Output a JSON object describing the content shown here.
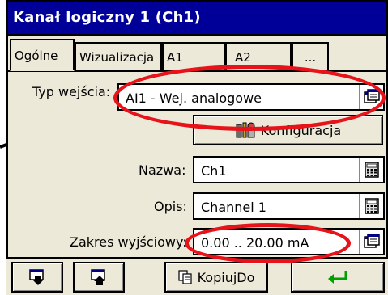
{
  "window": {
    "title": "Kanał logiczny 1 (Ch1)"
  },
  "tabs": [
    {
      "label": "Ogólne",
      "active": true
    },
    {
      "label": "Wizualizacja"
    },
    {
      "label": "A1"
    },
    {
      "label": "A2"
    },
    {
      "label": "..."
    }
  ],
  "form": {
    "input_type_label": "Typ wejścia:",
    "input_type_value": "AI1 - Wej. analogowe",
    "config_button": "Konfiguracja",
    "name_label": "Nazwa:",
    "name_value": "Ch1",
    "desc_label": "Opis:",
    "desc_value": "Channel 1",
    "range_label": "Zakres wyjściowy:",
    "range_value": "0.00 .. 20.00 mA"
  },
  "bottom": {
    "copy_label": "KopiujDo"
  },
  "colors": {
    "title_bg": "#000099",
    "highlight": "#e8121a",
    "enter_arrow": "#00a000"
  },
  "icons": [
    "list-select-icon",
    "tools-icon",
    "keypad-icon",
    "download-icon",
    "upload-icon",
    "copy-icon",
    "enter-icon"
  ]
}
